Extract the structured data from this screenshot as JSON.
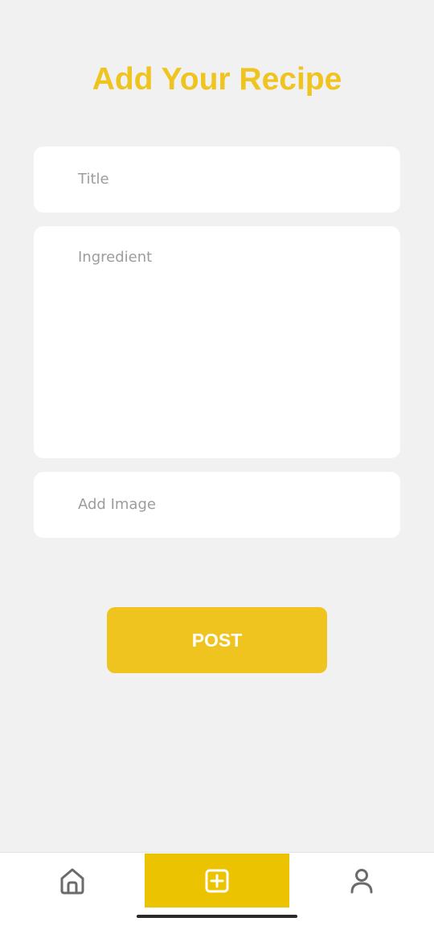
{
  "header": {
    "title": "Add Your Recipe"
  },
  "form": {
    "title_placeholder": "Title",
    "ingredient_placeholder": "Ingredient",
    "image_placeholder": "Add Image",
    "post_label": "POST"
  },
  "bottom_nav": {
    "items": [
      {
        "icon": "home-icon",
        "active": false
      },
      {
        "icon": "plus-square-icon",
        "active": true
      },
      {
        "icon": "user-icon",
        "active": false
      }
    ]
  },
  "colors": {
    "accent": "#efc41f",
    "nav_active_bg": "#ecc300",
    "background": "#f1f1f1",
    "placeholder": "#9c9c9c"
  }
}
